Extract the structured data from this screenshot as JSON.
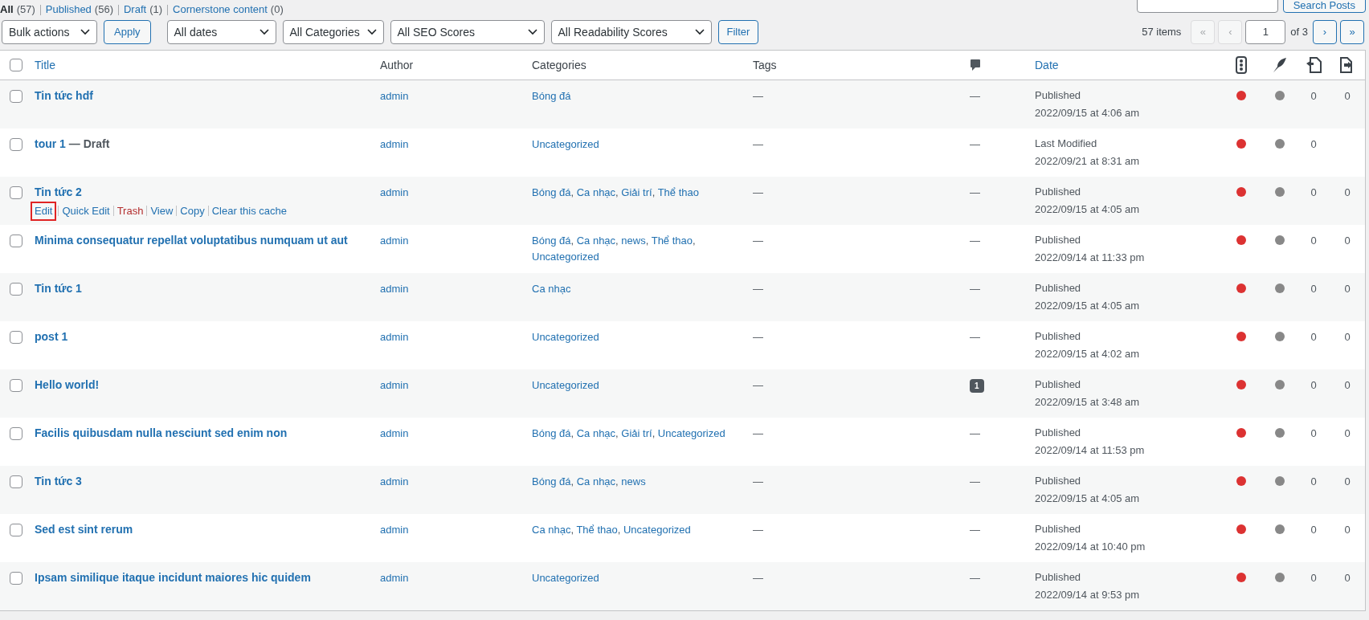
{
  "views": [
    {
      "label": "All",
      "count": "(57)",
      "selected": true
    },
    {
      "label": "Published",
      "count": "(56)",
      "selected": false
    },
    {
      "label": "Draft",
      "count": "(1)",
      "selected": false
    },
    {
      "label": "Cornerstone content",
      "count": "(0)",
      "selected": false
    }
  ],
  "search": {
    "button": "Search Posts"
  },
  "toolbar": {
    "bulk_actions": "Bulk actions",
    "apply": "Apply",
    "filters": [
      "All dates",
      "All Categories",
      "All SEO Scores",
      "All Readability Scores"
    ],
    "filter_button": "Filter"
  },
  "pagination": {
    "items": "57 items",
    "first": "«",
    "prev": "‹",
    "page": "1",
    "of": "of 3",
    "next": "›",
    "last": "»"
  },
  "category_separator": ", ",
  "select_all": {
    "checked": false
  },
  "columns": {
    "title": "Title",
    "author": "Author",
    "categories": "Categories",
    "tags": "Tags",
    "date": "Date"
  },
  "rows": [
    {
      "checked": false,
      "title": "Tin tức hdf",
      "suffix": "",
      "author": "admin",
      "categories": [
        "Bóng đá"
      ],
      "tags": "—",
      "comments": {
        "kind": "none",
        "text": "—"
      },
      "status": "Published",
      "date": "2022/09/15 at 4:06 am",
      "seo": {
        "color": "#dc3232"
      },
      "readability": {
        "color": "#888888"
      },
      "links": [
        "0",
        "0"
      ],
      "actions": []
    },
    {
      "checked": false,
      "title": "tour 1",
      "suffix": " — Draft",
      "author": "admin",
      "categories": [
        "Uncategorized"
      ],
      "tags": "—",
      "comments": {
        "kind": "none",
        "text": "—"
      },
      "status": "Last Modified",
      "date": "2022/09/21 at 8:31 am",
      "seo": {
        "color": "#dc3232"
      },
      "readability": {
        "color": "#888888"
      },
      "links": [
        "0"
      ],
      "actions": []
    },
    {
      "checked": false,
      "title": "Tin tức 2",
      "suffix": "",
      "author": "admin",
      "categories": [
        "Bóng đá",
        "Ca nhạc",
        "Giải trí",
        "Thể thao"
      ],
      "tags": "—",
      "comments": {
        "kind": "none",
        "text": "—"
      },
      "status": "Published",
      "date": "2022/09/15 at 4:05 am",
      "seo": {
        "color": "#dc3232"
      },
      "readability": {
        "color": "#888888"
      },
      "links": [
        "0",
        "0"
      ],
      "actions": [
        {
          "label": "Edit",
          "kind": "link",
          "highlighted": true
        },
        {
          "label": "Quick Edit",
          "kind": "link",
          "highlighted": false
        },
        {
          "label": "Trash",
          "kind": "delete",
          "highlighted": false
        },
        {
          "label": "View",
          "kind": "link",
          "highlighted": false
        },
        {
          "label": "Copy",
          "kind": "link",
          "highlighted": false
        },
        {
          "label": "Clear this cache",
          "kind": "link",
          "highlighted": false
        }
      ]
    },
    {
      "checked": false,
      "title": "Minima consequatur repellat voluptatibus numquam ut aut",
      "suffix": "",
      "author": "admin",
      "categories": [
        "Bóng đá",
        "Ca nhạc",
        "news",
        "Thể thao",
        "Uncategorized"
      ],
      "tags": "—",
      "comments": {
        "kind": "none",
        "text": "—"
      },
      "status": "Published",
      "date": "2022/09/14 at 11:33 pm",
      "seo": {
        "color": "#dc3232"
      },
      "readability": {
        "color": "#888888"
      },
      "links": [
        "0",
        "0"
      ],
      "actions": []
    },
    {
      "checked": false,
      "title": "Tin tức 1",
      "suffix": "",
      "author": "admin",
      "categories": [
        "Ca nhạc"
      ],
      "tags": "—",
      "comments": {
        "kind": "none",
        "text": "—"
      },
      "status": "Published",
      "date": "2022/09/15 at 4:05 am",
      "seo": {
        "color": "#dc3232"
      },
      "readability": {
        "color": "#888888"
      },
      "links": [
        "0",
        "0"
      ],
      "actions": []
    },
    {
      "checked": false,
      "title": "post 1",
      "suffix": "",
      "author": "admin",
      "categories": [
        "Uncategorized"
      ],
      "tags": "—",
      "comments": {
        "kind": "none",
        "text": "—"
      },
      "status": "Published",
      "date": "2022/09/15 at 4:02 am",
      "seo": {
        "color": "#dc3232"
      },
      "readability": {
        "color": "#888888"
      },
      "links": [
        "0",
        "0"
      ],
      "actions": []
    },
    {
      "checked": false,
      "title": "Hello world!",
      "suffix": "",
      "author": "admin",
      "categories": [
        "Uncategorized"
      ],
      "tags": "—",
      "comments": {
        "kind": "count",
        "text": "1"
      },
      "status": "Published",
      "date": "2022/09/15 at 3:48 am",
      "seo": {
        "color": "#dc3232"
      },
      "readability": {
        "color": "#888888"
      },
      "links": [
        "0",
        "0"
      ],
      "actions": []
    },
    {
      "checked": false,
      "title": "Facilis quibusdam nulla nesciunt sed enim non",
      "suffix": "",
      "author": "admin",
      "categories": [
        "Bóng đá",
        "Ca nhạc",
        "Giải trí",
        "Uncategorized"
      ],
      "tags": "—",
      "comments": {
        "kind": "none",
        "text": "—"
      },
      "status": "Published",
      "date": "2022/09/14 at 11:53 pm",
      "seo": {
        "color": "#dc3232"
      },
      "readability": {
        "color": "#888888"
      },
      "links": [
        "0",
        "0"
      ],
      "actions": []
    },
    {
      "checked": false,
      "title": "Tin tức 3",
      "suffix": "",
      "author": "admin",
      "categories": [
        "Bóng đá",
        "Ca nhạc",
        "news"
      ],
      "tags": "—",
      "comments": {
        "kind": "none",
        "text": "—"
      },
      "status": "Published",
      "date": "2022/09/15 at 4:05 am",
      "seo": {
        "color": "#dc3232"
      },
      "readability": {
        "color": "#888888"
      },
      "links": [
        "0",
        "0"
      ],
      "actions": []
    },
    {
      "checked": false,
      "title": "Sed est sint rerum",
      "suffix": "",
      "author": "admin",
      "categories": [
        "Ca nhạc",
        "Thể thao",
        "Uncategorized"
      ],
      "tags": "—",
      "comments": {
        "kind": "none",
        "text": "—"
      },
      "status": "Published",
      "date": "2022/09/14 at 10:40 pm",
      "seo": {
        "color": "#dc3232"
      },
      "readability": {
        "color": "#888888"
      },
      "links": [
        "0",
        "0"
      ],
      "actions": []
    },
    {
      "checked": false,
      "title": "Ipsam similique itaque incidunt maiores hic quidem",
      "suffix": "",
      "author": "admin",
      "categories": [
        "Uncategorized"
      ],
      "tags": "—",
      "comments": {
        "kind": "none",
        "text": "—"
      },
      "status": "Published",
      "date": "2022/09/14 at 9:53 pm",
      "seo": {
        "color": "#dc3232"
      },
      "readability": {
        "color": "#888888"
      },
      "links": [
        "0",
        "0"
      ],
      "actions": []
    }
  ]
}
